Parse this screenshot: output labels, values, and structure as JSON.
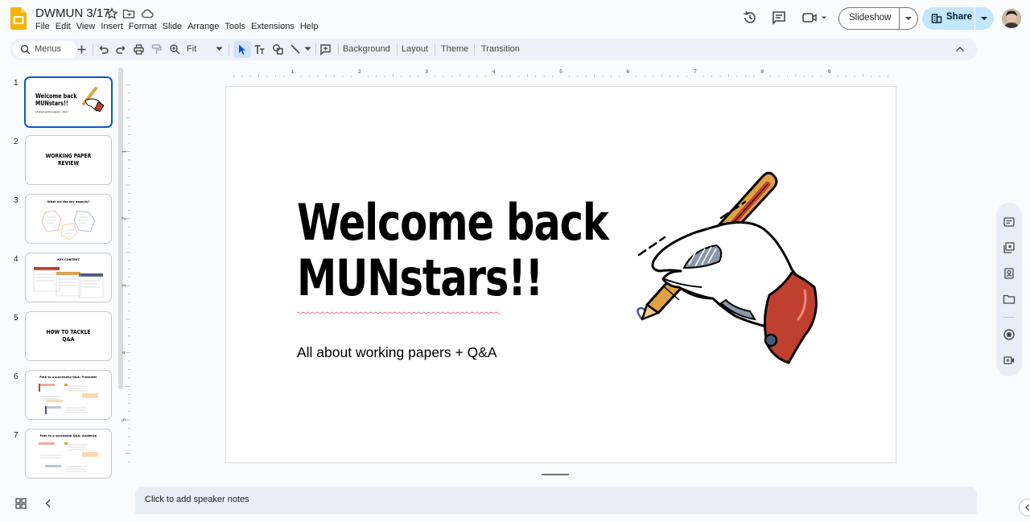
{
  "document": {
    "title": "DWMUN 3/17"
  },
  "menu": [
    "File",
    "Edit",
    "View",
    "Insert",
    "Format",
    "Slide",
    "Arrange",
    "Tools",
    "Extensions",
    "Help"
  ],
  "header": {
    "slideshow_label": "Slideshow",
    "share_label": "Share"
  },
  "toolbar": {
    "menus_label": "Menus",
    "zoom_label": "Fit",
    "background_label": "Background",
    "layout_label": "Layout",
    "theme_label": "Theme",
    "transition_label": "Transition"
  },
  "rulers": {
    "horizontal": [
      "1",
      "2",
      "3",
      "4",
      "5",
      "6",
      "7",
      "8",
      "9"
    ],
    "vertical": [
      "1",
      "2",
      "3",
      "4",
      "5"
    ]
  },
  "filmstrip": [
    {
      "number": "1",
      "title_lines": [
        "Welcome back",
        "MUNstars!!"
      ],
      "subtitle": "All about working papers + Q&A"
    },
    {
      "number": "2",
      "title_lines": [
        "WORKING PAPER",
        "REVIEW"
      ]
    },
    {
      "number": "3",
      "title_lines": [
        "What are the key aspects?"
      ]
    },
    {
      "number": "4",
      "title_lines": [
        "KEY CONTENT"
      ]
    },
    {
      "number": "5",
      "title_lines": [
        "HOW TO TACKLE",
        "Q&A"
      ]
    },
    {
      "number": "6",
      "title_lines": [
        "Path to a successful Q&A: Presenter"
      ]
    },
    {
      "number": "7",
      "title_lines": [
        "Path to a successful Q&A: Audience"
      ]
    }
  ],
  "slide": {
    "title_lines": [
      "Welcome back",
      "MUNstars!!"
    ],
    "subtitle": "All about working papers + Q&A"
  },
  "notes": {
    "placeholder": "Click to add speaker notes"
  },
  "colors": {
    "accent_blue": "#0b57d0",
    "share_bg": "#c2e7ff",
    "pen_orange": "#e0a144",
    "cuff_red": "#c0402f",
    "logo_yellow": "#f4b400"
  }
}
